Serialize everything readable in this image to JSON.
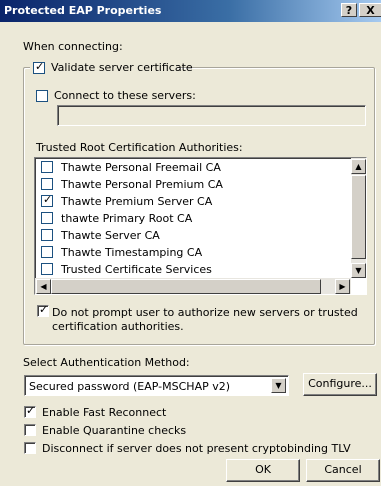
{
  "window": {
    "title": "Protected EAP Properties",
    "help_button": "?",
    "close_button": "X"
  },
  "when_connecting_label": "When connecting:",
  "validate_server_cert": {
    "label": "Validate server certificate",
    "checked": true
  },
  "connect_to_servers": {
    "label": "Connect to these servers:",
    "checked": false,
    "value": ""
  },
  "trusted_root_label": "Trusted Root Certification Authorities:",
  "ca_list": [
    {
      "name": "Thawte Personal Freemail CA",
      "checked": false
    },
    {
      "name": "Thawte Personal Premium CA",
      "checked": false
    },
    {
      "name": "Thawte Premium Server CA",
      "checked": true
    },
    {
      "name": "thawte Primary Root CA",
      "checked": false
    },
    {
      "name": "Thawte Server CA",
      "checked": false
    },
    {
      "name": "Thawte Timestamping CA",
      "checked": false
    },
    {
      "name": "Trusted Certificate Services",
      "checked": false
    }
  ],
  "do_not_prompt": {
    "label_line1": "Do not prompt user to authorize new servers or trusted",
    "label_line2": "certification authorities.",
    "checked": true
  },
  "auth_method": {
    "label": "Select Authentication Method:",
    "selected": "Secured password (EAP-MSCHAP v2)",
    "configure_label": "Configure..."
  },
  "options": {
    "fast_reconnect": {
      "label": "Enable Fast Reconnect",
      "checked": true
    },
    "quarantine": {
      "label": "Enable Quarantine checks",
      "checked": false
    },
    "cryptobinding": {
      "label": "Disconnect if server does not present cryptobinding TLV",
      "checked": false
    }
  },
  "buttons": {
    "ok": "OK",
    "cancel": "Cancel"
  },
  "colors": {
    "title_start": "#0a246a",
    "title_end": "#a6caf0",
    "dialog_bg": "#ece9d8"
  }
}
